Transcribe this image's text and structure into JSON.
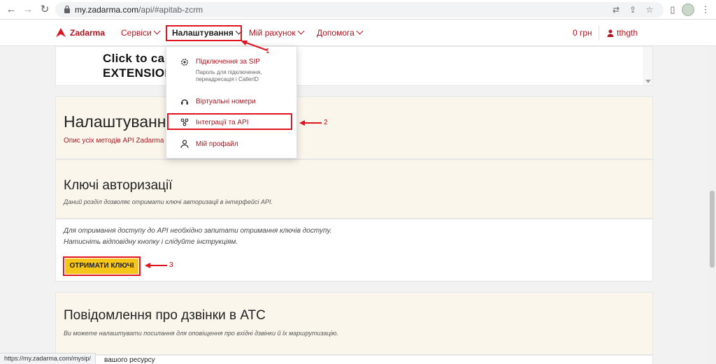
{
  "browser": {
    "url_host": "my.zadarma.com",
    "url_path": "/api/#apitab-zcrm",
    "status_url": "https://my.zadarma.com/mysip/"
  },
  "header": {
    "logo_text": "Zadarma",
    "nav": [
      {
        "label": "Сервіси"
      },
      {
        "label": "Налаштування"
      },
      {
        "label": "Мій рахунок"
      },
      {
        "label": "Допомога"
      }
    ],
    "balance": "0 грн",
    "user": "tthgth"
  },
  "banner": {
    "line1": "Click to ca",
    "line2": "EXTENSION"
  },
  "dropdown": {
    "items": [
      {
        "label": "Підключення за SIP",
        "desc1": "Пароль для підключення,",
        "desc2": "переадресація і CallerID",
        "icon": "gear-icon"
      },
      {
        "label": "Віртуальні номери",
        "icon": "headset-icon"
      },
      {
        "label": "Інтеграції та API",
        "icon": "integration-icon"
      },
      {
        "label": "Мій профайл",
        "icon": "user-icon"
      }
    ]
  },
  "section_settings": {
    "title": "Налаштуванн",
    "link": "Опис усіх методів API Zadarma"
  },
  "section_keys": {
    "title": "Ключі авторизації",
    "subtitle": "Даний розділ дозволяє отримати ключі авторизації в інтерфейсі API.",
    "body_line1": "Для отримання доступу до API необхідно запитати отримання ключів доступу.",
    "body_line2": "Натисніть відповідну кнопку і слідуйте інструкціям.",
    "button": "ОТРИМАТИ КЛЮЧІ"
  },
  "section_notify": {
    "title": "Повідомлення про дзвінки в АТС",
    "subtitle": "Ви можете налаштувати посилання для оповіщення про вхідні дзвінки й їх маршрутизацію.",
    "peek": "вашого ресурсу"
  },
  "annotations": [
    "1",
    "2",
    "3"
  ],
  "colors": {
    "brand": "#b0141f",
    "annotation": "#e0141f",
    "button": "#f5c518"
  }
}
